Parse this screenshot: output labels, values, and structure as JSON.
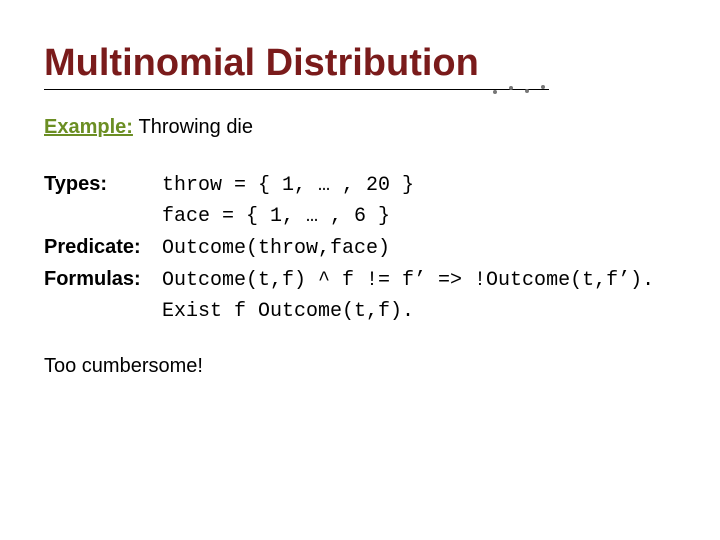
{
  "title": "Multinomial Distribution",
  "subtitle": {
    "label": "Example:",
    "desc": "Throwing die"
  },
  "rows": {
    "types": {
      "label": "Types:",
      "line1": "throw = { 1, … , 20 }",
      "line2": "face = { 1, … , 6 }"
    },
    "predicate": {
      "label": "Predicate:",
      "line1": "Outcome(throw,face)"
    },
    "formulas": {
      "label": "Formulas:",
      "line1": "Outcome(t,f) ^ f != f’ => !Outcome(t,f’).",
      "line2": "Exist f Outcome(t,f)."
    }
  },
  "footer": "Too cumbersome!"
}
